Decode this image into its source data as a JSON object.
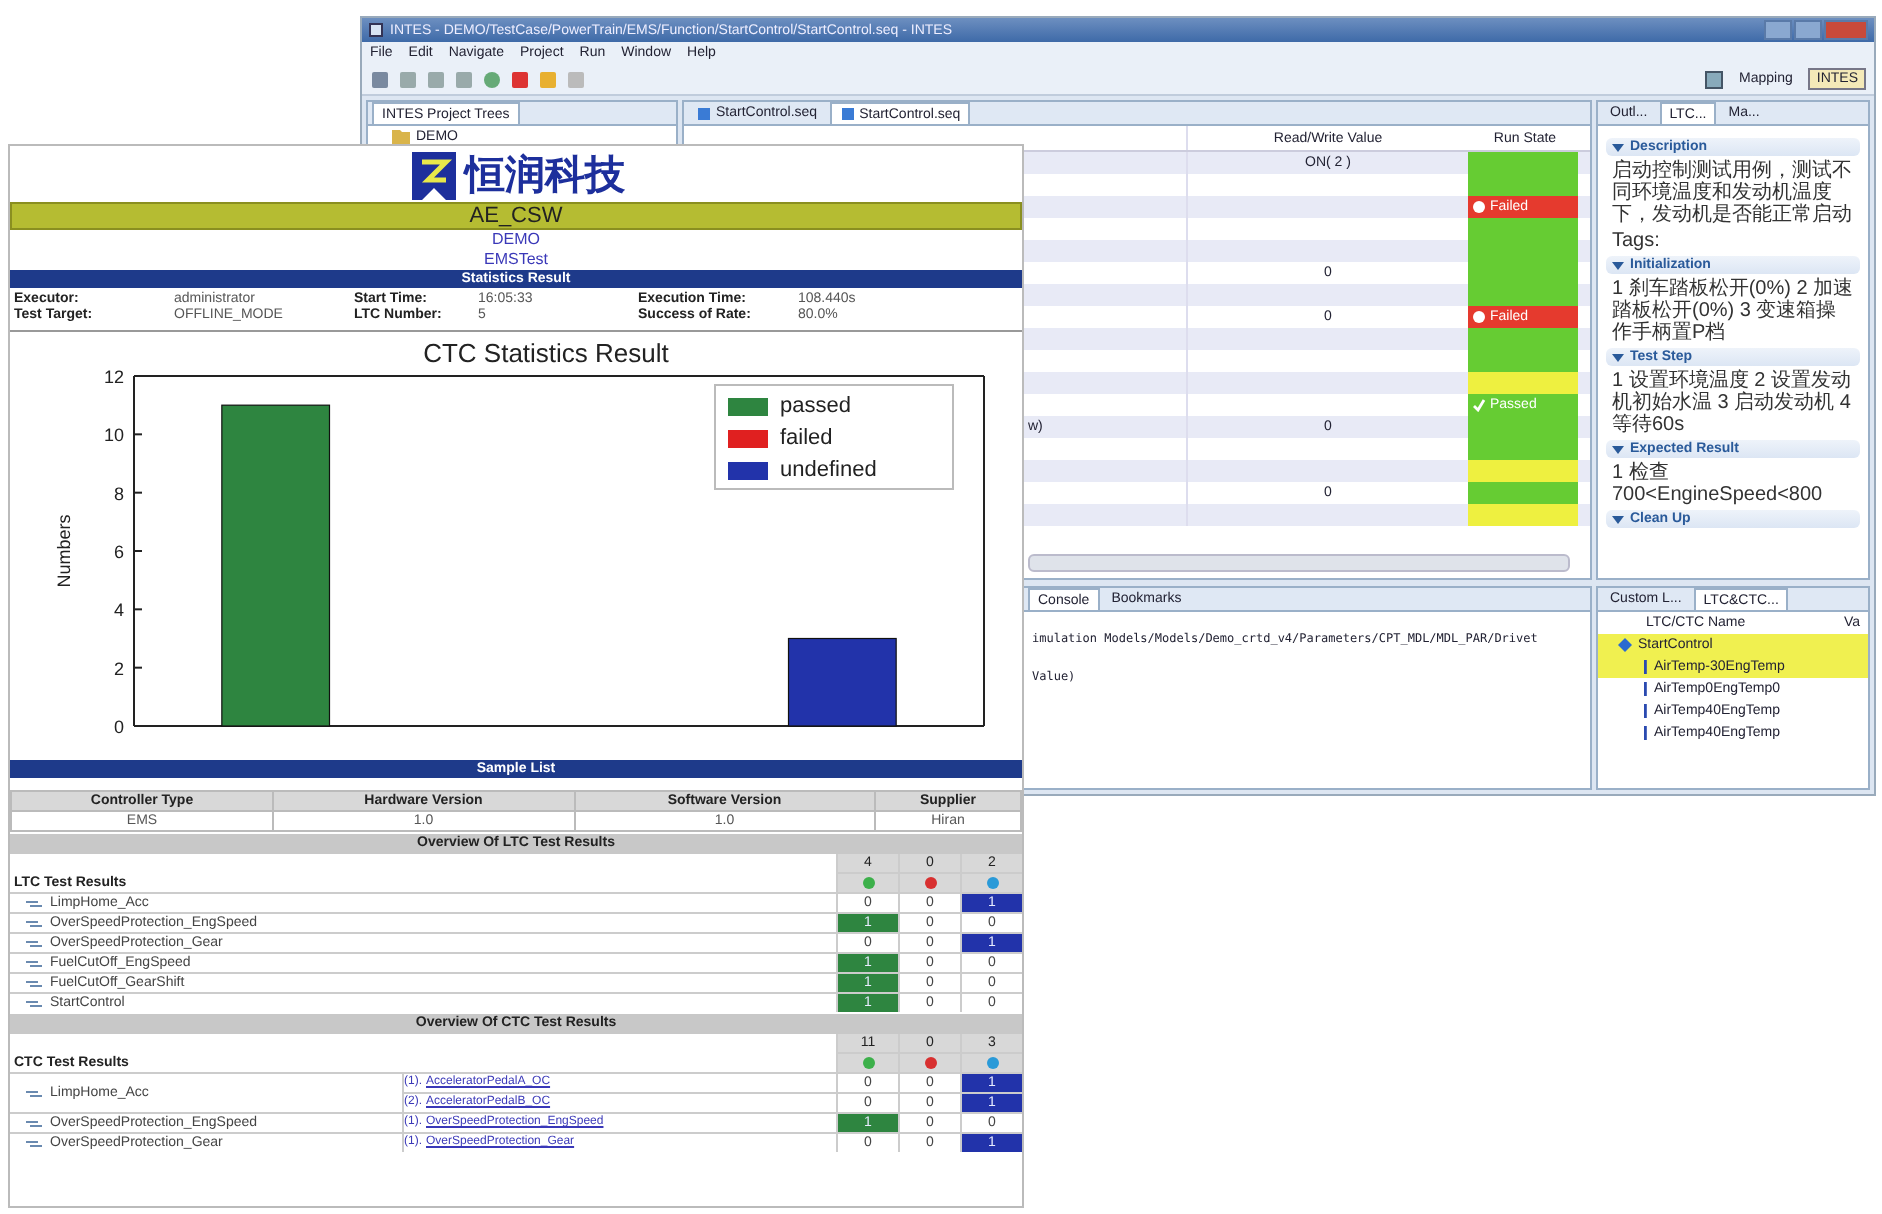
{
  "ide": {
    "title": "INTES - DEMO/TestCase/PowerTrain/EMS/Function/StartControl/StartControl.seq - INTES",
    "menu": [
      "File",
      "Edit",
      "Navigate",
      "Project",
      "Run",
      "Window",
      "Help"
    ],
    "perspectives": [
      {
        "label": "Mapping",
        "selected": false
      },
      {
        "label": "INTES",
        "selected": true
      }
    ],
    "project_panel": {
      "tab": "INTES Project Trees",
      "tree": [
        {
          "label": "DEMO"
        }
      ]
    },
    "editor": {
      "tabs": [
        {
          "label": "StartControl.seq",
          "selected": false
        },
        {
          "label": "StartControl.seq",
          "selected": true
        }
      ],
      "columns": [
        "Read/Write Value",
        "Run State"
      ],
      "rows": [
        {
          "value": "ON( 2 )",
          "color": "#66cc33"
        },
        {
          "color": "#66cc33"
        },
        {
          "color": "#e53a2e",
          "status": {
            "kind": "failed",
            "label": "Failed"
          }
        },
        {
          "color": "#66cc33"
        },
        {
          "color": "#66cc33"
        },
        {
          "value": "0",
          "color": "#66cc33"
        },
        {
          "color": "#66cc33"
        },
        {
          "value": "0",
          "color": "#e53a2e",
          "status": {
            "kind": "failed",
            "label": "Failed"
          }
        },
        {
          "color": "#66cc33"
        },
        {
          "color": "#66cc33"
        },
        {
          "color": "#eef040"
        },
        {
          "color": "#66cc33",
          "status": {
            "kind": "passed",
            "label": "Passed"
          }
        },
        {
          "step": "w)",
          "value": "0",
          "color": "#66cc33"
        },
        {
          "color": "#66cc33"
        },
        {
          "color": "#eef040"
        },
        {
          "value": "0",
          "color": "#66cc33"
        },
        {
          "color": "#eef040"
        }
      ]
    },
    "side_panel": {
      "tabs": [
        {
          "label": "Outl...",
          "selected": false
        },
        {
          "label": "LTC...",
          "selected": true
        },
        {
          "label": "Ma...",
          "selected": false
        }
      ],
      "sections": [
        {
          "title": "Description",
          "lines": [
            "启动控制测试用例，测试不同环境温度和发动机温度下，发动机是否能正常启动",
            "Tags:"
          ]
        },
        {
          "title": "Initialization",
          "lines": [
            "1 刹车踏板松开(0%) 2 加速踏板松开(0%) 3 变速箱操作手柄置P档"
          ]
        },
        {
          "title": "Test Step",
          "lines": [
            "1 设置环境温度 2 设置发动机初始水温 3 启动发动机 4 等待60s"
          ]
        },
        {
          "title": "Expected Result",
          "lines": [
            "1 检查700<EngineSpeed<800"
          ]
        },
        {
          "title": "Clean Up"
        }
      ]
    },
    "console": {
      "tabs": [
        {
          "label": "Console",
          "selected": true
        },
        {
          "label": "Bookmarks",
          "selected": false
        }
      ],
      "lines": [
        "imulation Models/Models/Demo_crtd_v4/Parameters/CPT_MDL/MDL_PAR/Drivet",
        "Value)"
      ]
    },
    "ltc_panel": {
      "tabs": [
        {
          "label": "Custom L...",
          "selected": false
        },
        {
          "label": "LTC&CTC...",
          "selected": true
        }
      ],
      "columns": [
        "LTC/CTC Name",
        "Va"
      ],
      "tree": [
        {
          "label": "StartControl",
          "selected": true,
          "expanded": true,
          "children": [
            {
              "label": "AirTemp-30EngTemp",
              "selected": true
            },
            {
              "label": "AirTemp0EngTemp0",
              "selected": false
            },
            {
              "label": "AirTemp40EngTemp",
              "selected": false
            },
            {
              "label": "AirTemp40EngTemp",
              "selected": false
            }
          ]
        }
      ]
    }
  },
  "report": {
    "logo": "恒润科技",
    "project": "AE_CSW",
    "lines": [
      "DEMO",
      "EMSTest"
    ],
    "stats_title": "Statistics Result",
    "stats": [
      {
        "label": "Executor:",
        "value": "administrator"
      },
      {
        "label": "Start Time:",
        "value": "16:05:33"
      },
      {
        "label": "Execution Time:",
        "value": "108.440s"
      },
      {
        "label": "Test Target:",
        "value": "OFFLINE_MODE"
      },
      {
        "label": "LTC Number:",
        "value": "5"
      },
      {
        "label": "Success of Rate:",
        "value": "80.0%"
      }
    ],
    "chart_data": {
      "type": "bar",
      "categories": [
        null,
        null,
        null
      ],
      "legend": "upper right",
      "title": "CTC Statistics Result",
      "ylabel": "Numbers",
      "ylim": [
        0,
        12
      ],
      "yticks": [
        0,
        2,
        4,
        6,
        8,
        10,
        12
      ],
      "series": [
        {
          "name": "passed",
          "color": "#2e8540",
          "values": [
            11,
            null,
            null
          ]
        },
        {
          "name": "failed",
          "color": "#e02020",
          "values": [
            null,
            0,
            null
          ]
        },
        {
          "name": "undefined",
          "color": "#2233aa",
          "values": [
            null,
            null,
            3
          ]
        }
      ]
    },
    "sample_list": {
      "title": "Sample List",
      "columns": [
        "Controller Type",
        "Hardware Version",
        "Software Version",
        "Supplier"
      ],
      "rows": [
        [
          "EMS",
          "1.0",
          "1.0",
          "Hiran"
        ]
      ]
    },
    "ltc_overview": {
      "title": "Overview Of LTC Test Results",
      "label": "LTC Test  Results",
      "result_columns": [
        {
          "kind": "passed",
          "total": "4"
        },
        {
          "kind": "failed",
          "total": "0"
        },
        {
          "kind": "undefined",
          "total": "2"
        }
      ],
      "rows": [
        {
          "name": "LimpHome_Acc",
          "counts": [
            {
              "value": "0",
              "highlighted": false
            },
            {
              "value": "0",
              "highlighted": false
            },
            {
              "value": "1",
              "highlighted": true
            }
          ]
        },
        {
          "name": "OverSpeedProtection_EngSpeed",
          "counts": [
            {
              "value": "1",
              "highlighted": true
            },
            {
              "value": "0",
              "highlighted": false
            },
            {
              "value": "0",
              "highlighted": false
            }
          ]
        },
        {
          "name": "OverSpeedProtection_Gear",
          "counts": [
            {
              "value": "0",
              "highlighted": false
            },
            {
              "value": "0",
              "highlighted": false
            },
            {
              "value": "1",
              "highlighted": true
            }
          ]
        },
        {
          "name": "FuelCutOff_EngSpeed",
          "counts": [
            {
              "value": "1",
              "highlighted": true
            },
            {
              "value": "0",
              "highlighted": false
            },
            {
              "value": "0",
              "highlighted": false
            }
          ]
        },
        {
          "name": "FuelCutOff_GearShift",
          "counts": [
            {
              "value": "1",
              "highlighted": true
            },
            {
              "value": "0",
              "highlighted": false
            },
            {
              "value": "0",
              "highlighted": false
            }
          ]
        },
        {
          "name": "StartControl",
          "counts": [
            {
              "value": "1",
              "highlighted": true
            },
            {
              "value": "0",
              "highlighted": false
            },
            {
              "value": "0",
              "highlighted": false
            }
          ]
        }
      ]
    },
    "ctc_overview": {
      "title": "Overview Of CTC Test Results",
      "label": "CTC Test  Results",
      "result_columns": [
        {
          "kind": "passed",
          "total": "11"
        },
        {
          "kind": "failed",
          "total": "0"
        },
        {
          "kind": "undefined",
          "total": "3"
        }
      ],
      "rows": [
        {
          "name": "LimpHome_Acc",
          "cases": [
            {
              "index": "(1).",
              "link": "AcceleratorPedalA_OC",
              "counts": [
                {
                  "value": "0",
                  "highlighted": false
                },
                {
                  "value": "0",
                  "highlighted": false
                },
                {
                  "value": "1",
                  "highlighted": true
                }
              ]
            },
            {
              "index": "(2).",
              "link": "AcceleratorPedalB_OC",
              "counts": [
                {
                  "value": "0",
                  "highlighted": false
                },
                {
                  "value": "0",
                  "highlighted": false
                },
                {
                  "value": "1",
                  "highlighted": true
                }
              ]
            }
          ]
        },
        {
          "name": "OverSpeedProtection_EngSpeed",
          "cases": [
            {
              "index": "(1).",
              "link": "OverSpeedProtection_EngSpeed",
              "counts": [
                {
                  "value": "1",
                  "highlighted": true
                },
                {
                  "value": "0",
                  "highlighted": false
                },
                {
                  "value": "0",
                  "highlighted": false
                }
              ]
            }
          ]
        },
        {
          "name": "OverSpeedProtection_Gear",
          "cases": [
            {
              "index": "(1).",
              "link": "OverSpeedProtection_Gear",
              "counts": [
                {
                  "value": "0",
                  "highlighted": false
                },
                {
                  "value": "0",
                  "highlighted": false
                },
                {
                  "value": "1",
                  "highlighted": true
                }
              ]
            }
          ]
        }
      ]
    }
  }
}
